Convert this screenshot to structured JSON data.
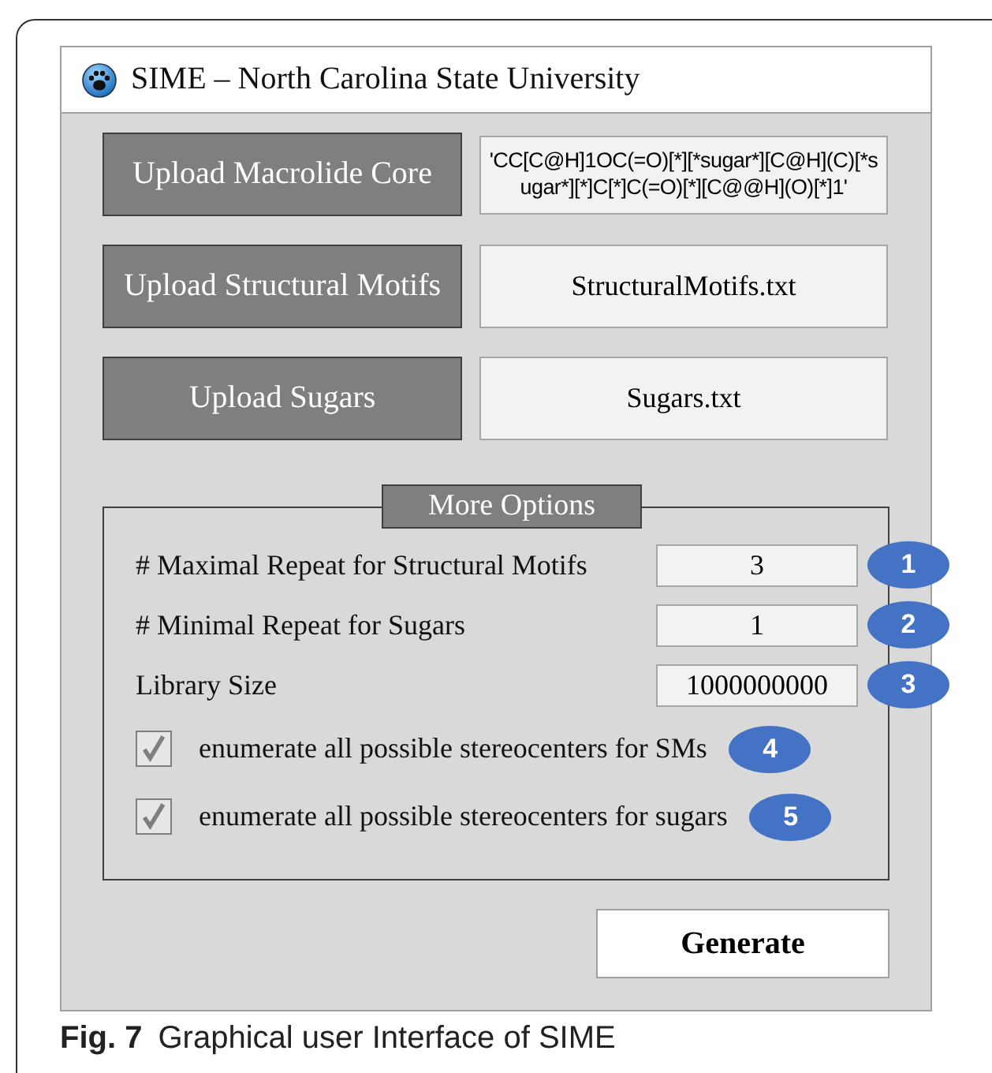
{
  "window": {
    "title": "SIME – North Carolina State University"
  },
  "uploads": [
    {
      "button": "Upload Macrolide Core",
      "value": "'CC[C@H]1OC(=O)[*][*sugar*][C@H](C)[*sugar*][*]C[*]C(=O)[*][C@@H](O)[*]1'",
      "kind": "smiles"
    },
    {
      "button": "Upload Structural Motifs",
      "value": "StructuralMotifs.txt",
      "kind": "file"
    },
    {
      "button": "Upload Sugars",
      "value": "Sugars.txt",
      "kind": "file"
    }
  ],
  "more_options": {
    "title": "More Options",
    "fields": [
      {
        "label": "# Maximal Repeat for Structural Motifs",
        "value": "3",
        "badge": "1"
      },
      {
        "label": "# Minimal Repeat for Sugars",
        "value": "1",
        "badge": "2"
      },
      {
        "label": "Library Size",
        "value": "1000000000",
        "badge": "3"
      }
    ],
    "checkboxes": [
      {
        "label": "enumerate all possible stereocenters for SMs",
        "checked": true,
        "badge": "4"
      },
      {
        "label": "enumerate all possible stereocenters for sugars",
        "checked": true,
        "badge": "5"
      }
    ]
  },
  "generate_button": "Generate",
  "caption": {
    "label": "Fig. 7",
    "text": "Graphical user Interface of SIME"
  }
}
